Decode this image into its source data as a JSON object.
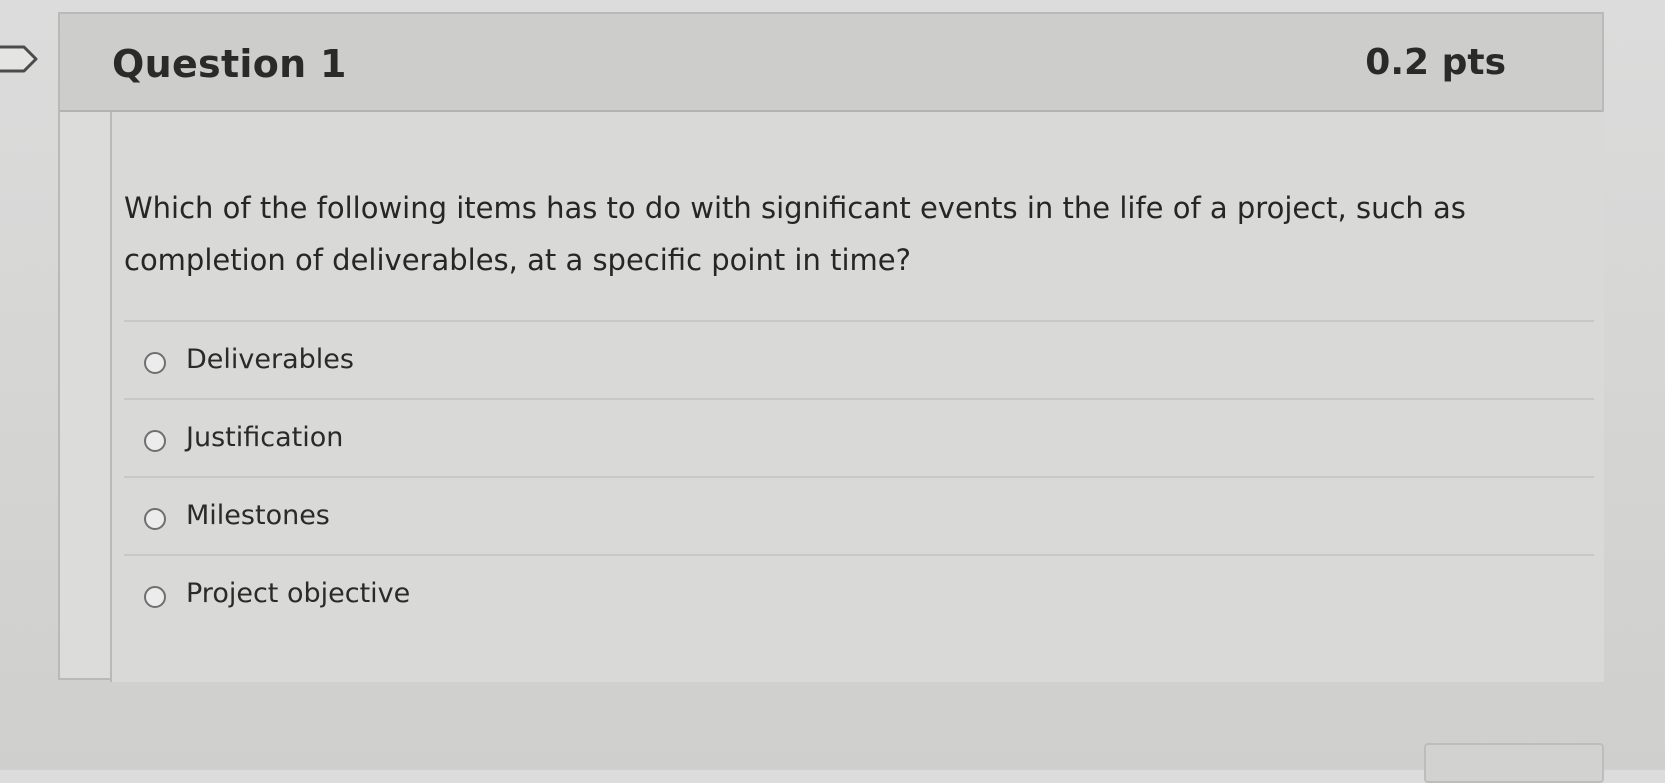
{
  "question": {
    "title": "Question 1",
    "points": "0.2 pts",
    "text": "Which of the following items has to do with significant events in the life of a project, such as completion of deliverables, at a specific point in time?"
  },
  "answers": [
    {
      "label": "Deliverables"
    },
    {
      "label": "Justification"
    },
    {
      "label": "Milestones"
    },
    {
      "label": "Project objective"
    }
  ],
  "icons": {
    "bookmark": "bookmark-flag-icon",
    "radio": "radio-unselected-icon"
  },
  "colors": {
    "header_bg": "#cdcdcc",
    "body_bg": "#d9d9d8",
    "border": "#b9b9b8",
    "text": "#2a2a2a"
  }
}
